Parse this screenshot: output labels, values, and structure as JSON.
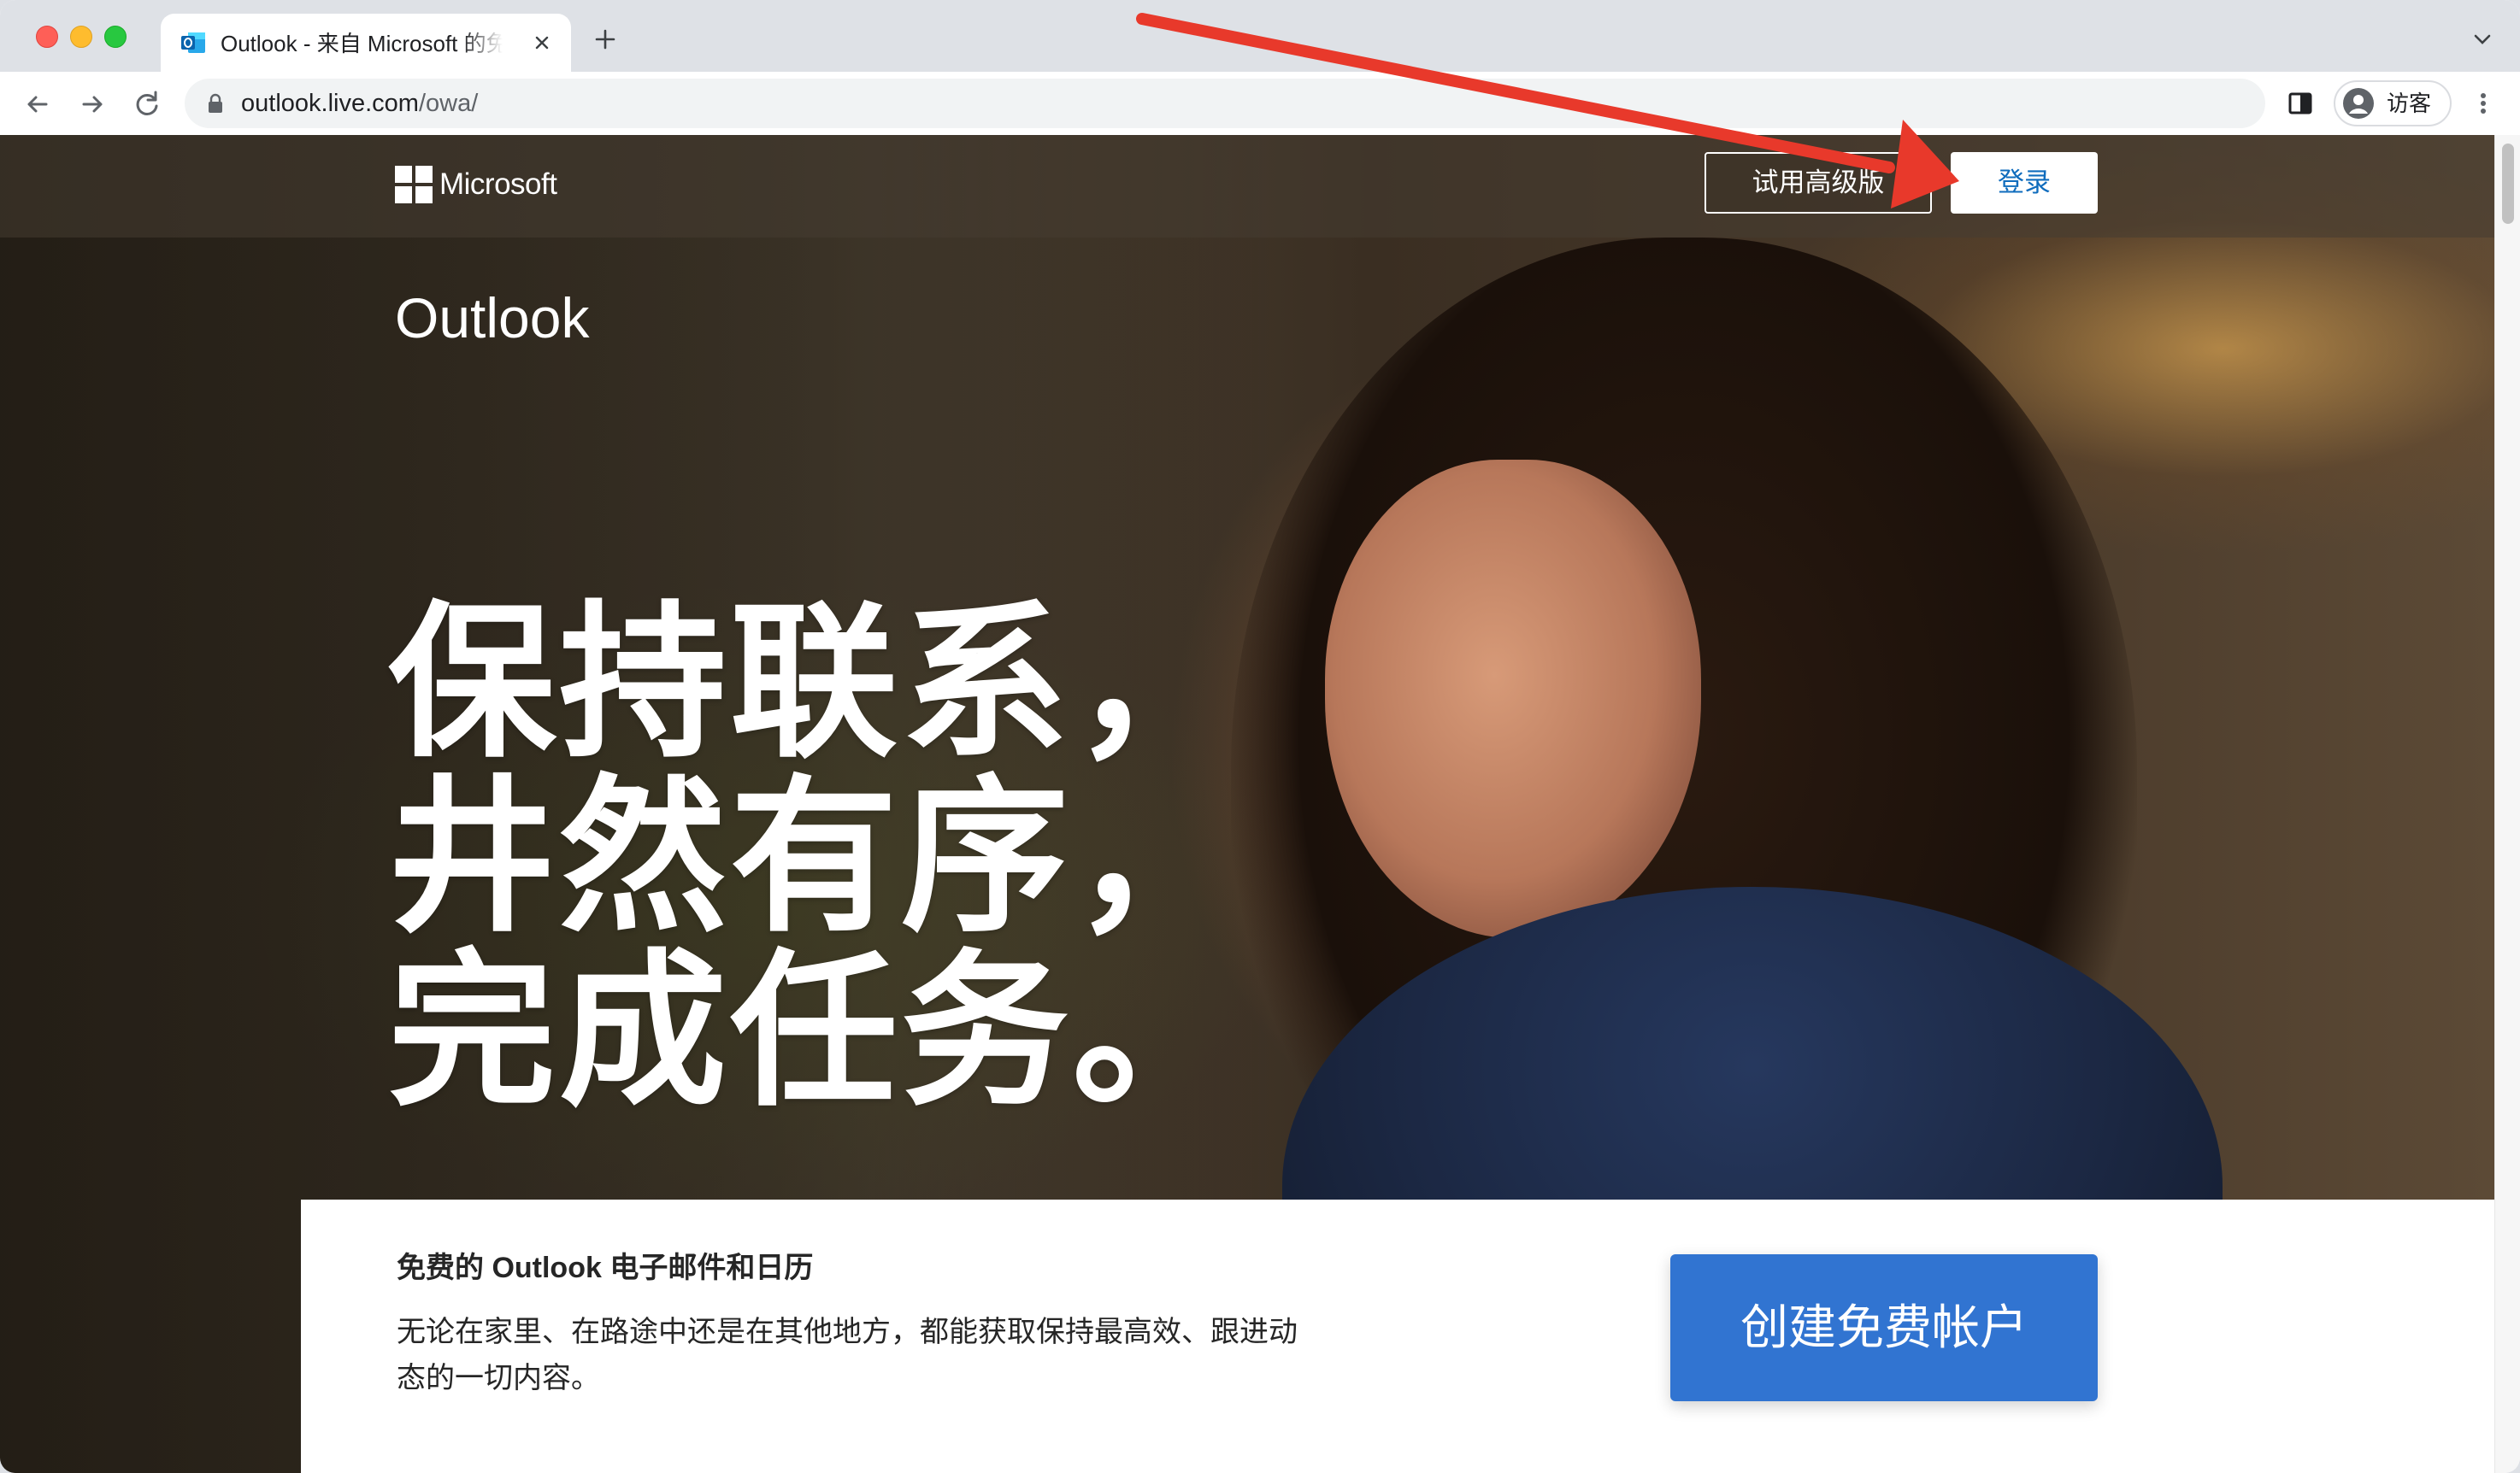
{
  "browser": {
    "tab": {
      "title": "Outlook - 来自 Microsoft 的免费",
      "favicon": "outlook-favicon-icon"
    },
    "address_bar": {
      "host": "outlook.live.com",
      "path": "/owa/"
    },
    "profile": {
      "label": "访客"
    }
  },
  "site": {
    "brand": "Microsoft",
    "header_buttons": {
      "premium": "试用高级版",
      "sign_in": "登录"
    },
    "product_title": "Outlook",
    "headline_lines": [
      "保持联系，",
      "井然有序，",
      "完成任务。"
    ],
    "card": {
      "heading": "免费的 Outlook 电子邮件和日历",
      "body": "无论在家里、在路途中还是在其他地方，都能获取保持最高效、跟进动态的一切内容。",
      "cta": "创建免费帐户"
    }
  },
  "colors": {
    "sign_in_text": "#0f6cbd",
    "cta_background": "#3174d1",
    "annotation_arrow": "#e8392b"
  }
}
